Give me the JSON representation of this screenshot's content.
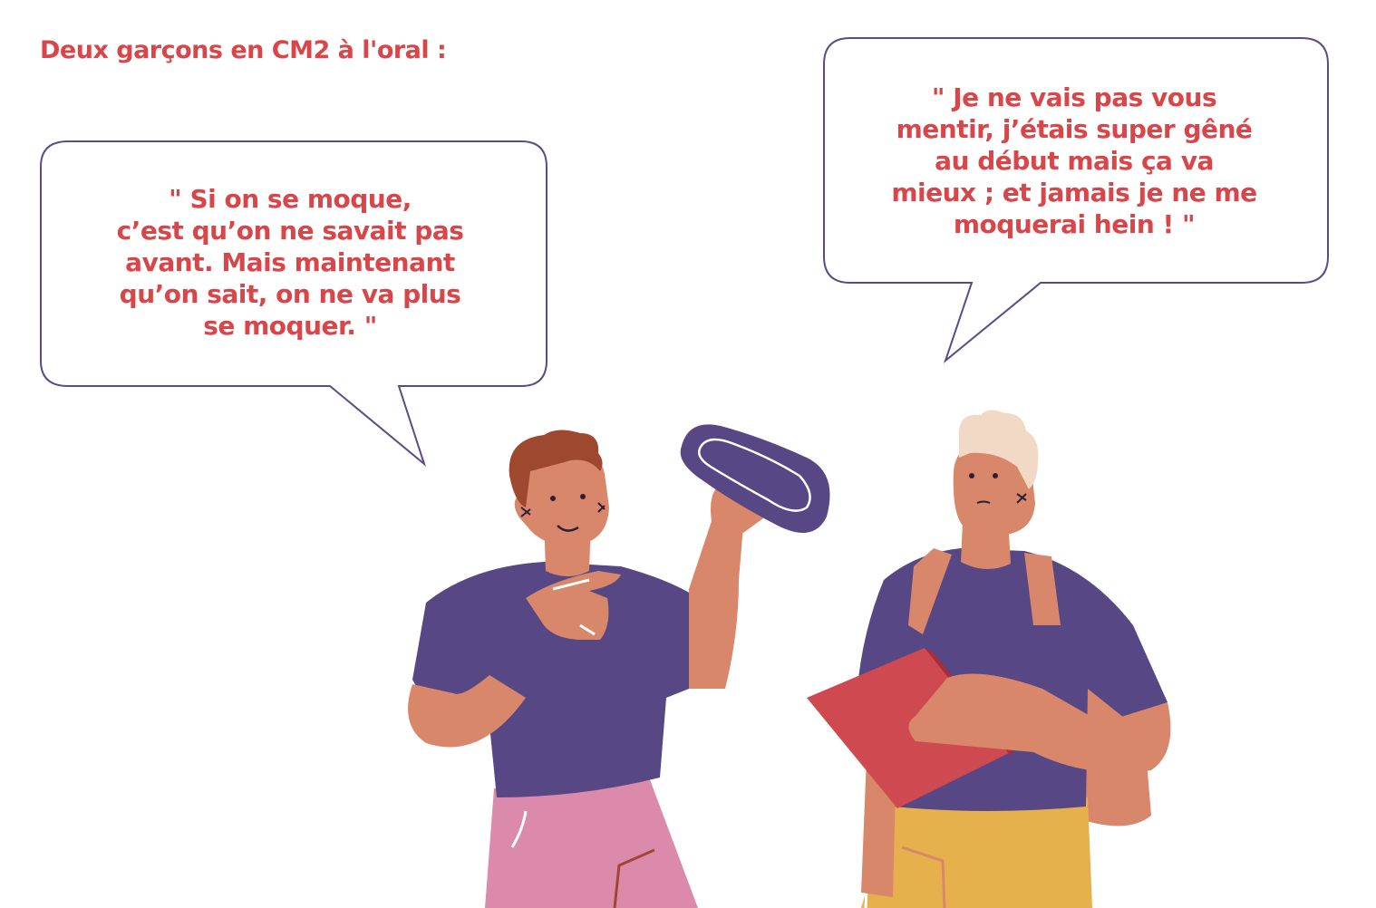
{
  "colors": {
    "text": "#d8464a",
    "bubble_stroke": "#5b4b86",
    "shirt": "#574785",
    "skin": "#d8876a",
    "hair_left": "#9e4830",
    "hair_right": "#f1d9c6",
    "shorts_left": "#dc8aab",
    "shorts_right": "#e6b04c",
    "pad": "#574785",
    "notebook": "#cf4a50"
  },
  "title": "Deux garçons en CM2 à l'oral :",
  "quote_left": {
    "lines": [
      "\" Si on se moque,",
      "c’est qu’on ne savait pas",
      "avant. Mais maintenant",
      "qu’on sait, on ne va plus",
      "se moquer. \""
    ]
  },
  "quote_right": {
    "lines": [
      "\" Je ne vais pas vous",
      "mentir, j’étais super gêné",
      "au début mais ça va",
      "mieux ; et jamais je ne me",
      "moquerai hein ! \""
    ]
  },
  "illustration": {
    "left_character": "boy-holding-sanitary-pad",
    "right_character": "boy-with-backpack-and-notebook",
    "held_object": "sanitary-pad-icon"
  }
}
